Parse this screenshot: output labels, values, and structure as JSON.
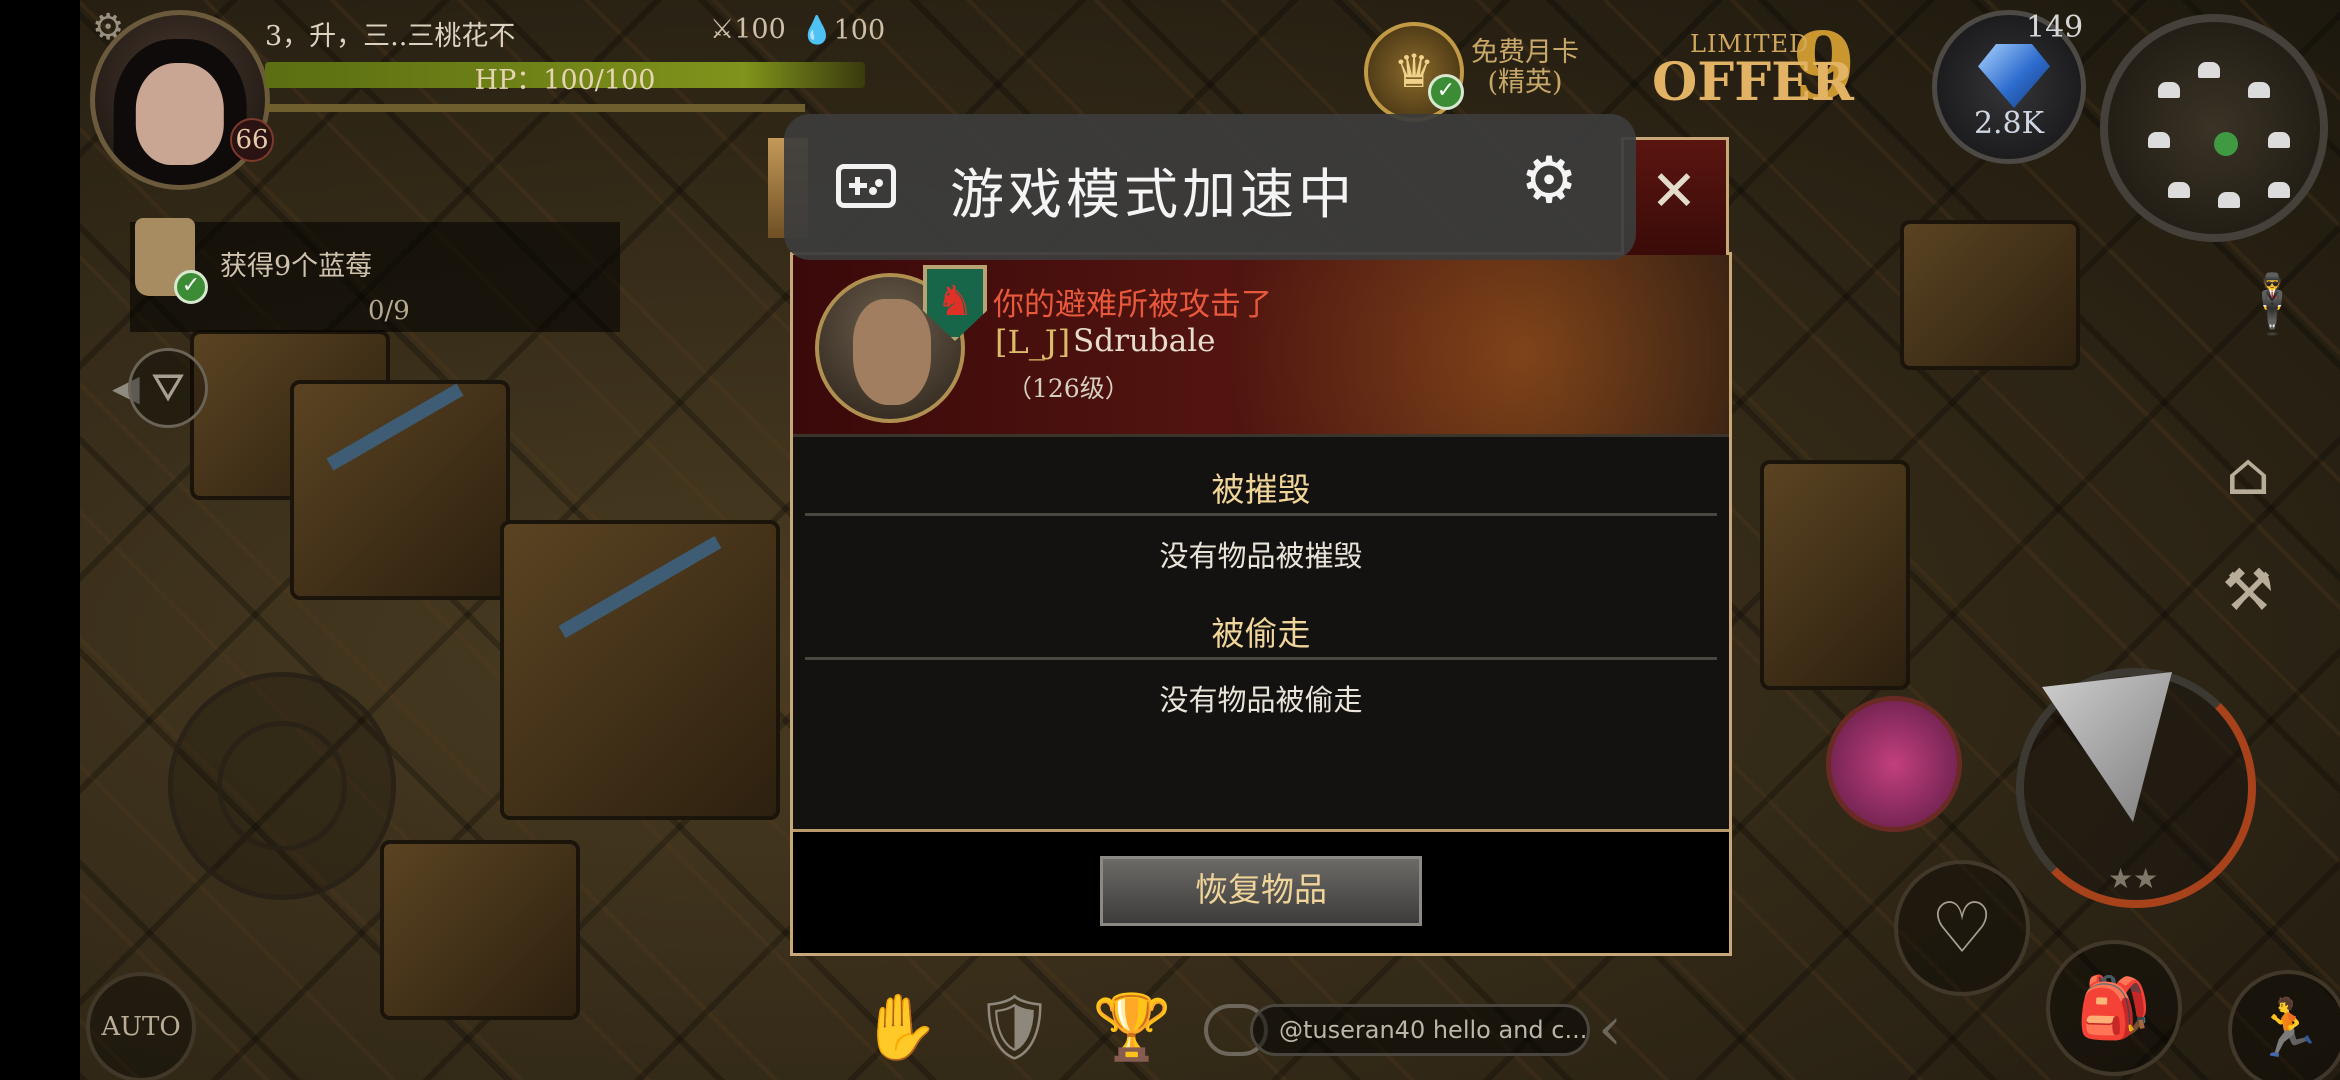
{
  "player": {
    "name": "3，升，三..三桃花不",
    "hp_text": "HP：100/100",
    "level": "66",
    "attack": "100",
    "defense": "100"
  },
  "quest": {
    "text": "获得9个蓝莓",
    "progress": "0/9"
  },
  "hud": {
    "auto_label": "AUTO",
    "promo_label_line1": "免费月卡",
    "promo_label_line2": "(精英)",
    "offer_small": "LIMITED",
    "offer_big": "OFFER",
    "offer_number": "9",
    "gem_level": "149",
    "gem_count": "2.8K",
    "stars": "★★",
    "chat_preview": "@tuseran40 hello and c..."
  },
  "popup": {
    "attack_title": "你的避难所被攻击了",
    "attacker_tag": "[L_J]",
    "attacker_name": "Sdrubale",
    "attacker_level": "（126级）",
    "close_glyph": "✕",
    "destroyed_title": "被摧毁",
    "destroyed_text": "没有物品被摧毁",
    "stolen_title": "被偷走",
    "stolen_text": "没有物品被偷走",
    "restore_button": "恢复物品"
  },
  "overlay": {
    "mode_text": "游戏模式加速中"
  },
  "icons": {
    "gear": "gear-icon",
    "gamepad": "gamepad-icon",
    "close": "close-icon",
    "check": "check-icon"
  },
  "colors": {
    "attack_title": "#e8583b",
    "section_title": "#f0d59a",
    "popup_border": "#c8a878",
    "hp_bar": "#80931b"
  }
}
